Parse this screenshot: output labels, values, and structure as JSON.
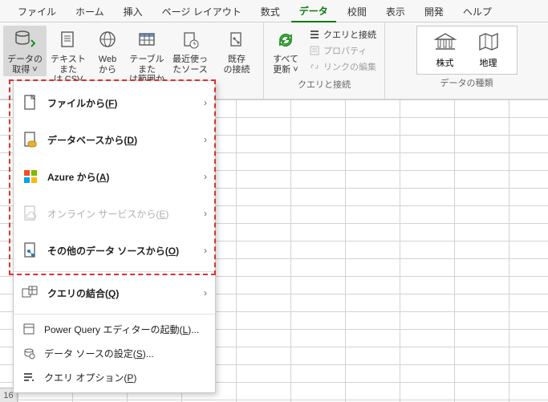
{
  "tabs": {
    "file": "ファイル",
    "home": "ホーム",
    "insert": "挿入",
    "pagelayout": "ページ レイアウト",
    "formulas": "数式",
    "data": "データ",
    "review": "校閲",
    "view": "表示",
    "developer": "開発",
    "help": "ヘルプ"
  },
  "ribbon": {
    "getdata": {
      "l1": "データの",
      "l2": "取得 ˅"
    },
    "fromtext": {
      "l1": "テキストまた",
      "l2": "は CSV から"
    },
    "fromweb": {
      "l1": "Web",
      "l2": "から"
    },
    "fromtable": {
      "l1": "テーブルまた",
      "l2": "は範囲から"
    },
    "recent": {
      "l1": "最近使っ",
      "l2": "たソース"
    },
    "existing": {
      "l1": "既存",
      "l2": "の接続"
    },
    "refresh": {
      "l1": "すべて",
      "l2": "更新 ˅"
    },
    "queries": "クエリと接続",
    "properties": "プロパティ",
    "editlinks": "リンクの編集",
    "group_queries": "クエリと接続",
    "stocks": "株式",
    "geo": "地理",
    "group_types": "データの種類"
  },
  "menu": {
    "fromfile": "ファイルから",
    "fromfile_key": "F",
    "fromdb": "データベースから",
    "fromdb_key": "D",
    "fromazure": "Azure から",
    "fromazure_key": "A",
    "fromonline": "オンライン サービスから",
    "fromonline_key": "E",
    "fromother": "その他のデータ ソースから",
    "fromother_key": "O",
    "combine": "クエリの結合",
    "combine_key": "Q",
    "launcheditor": "Power Query エディターの起動",
    "launcheditor_key": "L",
    "launcheditor_suffix": "...",
    "dssettings": "データ ソースの設定",
    "dssettings_key": "S",
    "dssettings_suffix": "...",
    "queryoptions": "クエリ オプション",
    "queryoptions_key": "P"
  },
  "rownum": "16",
  "chevron": "›"
}
